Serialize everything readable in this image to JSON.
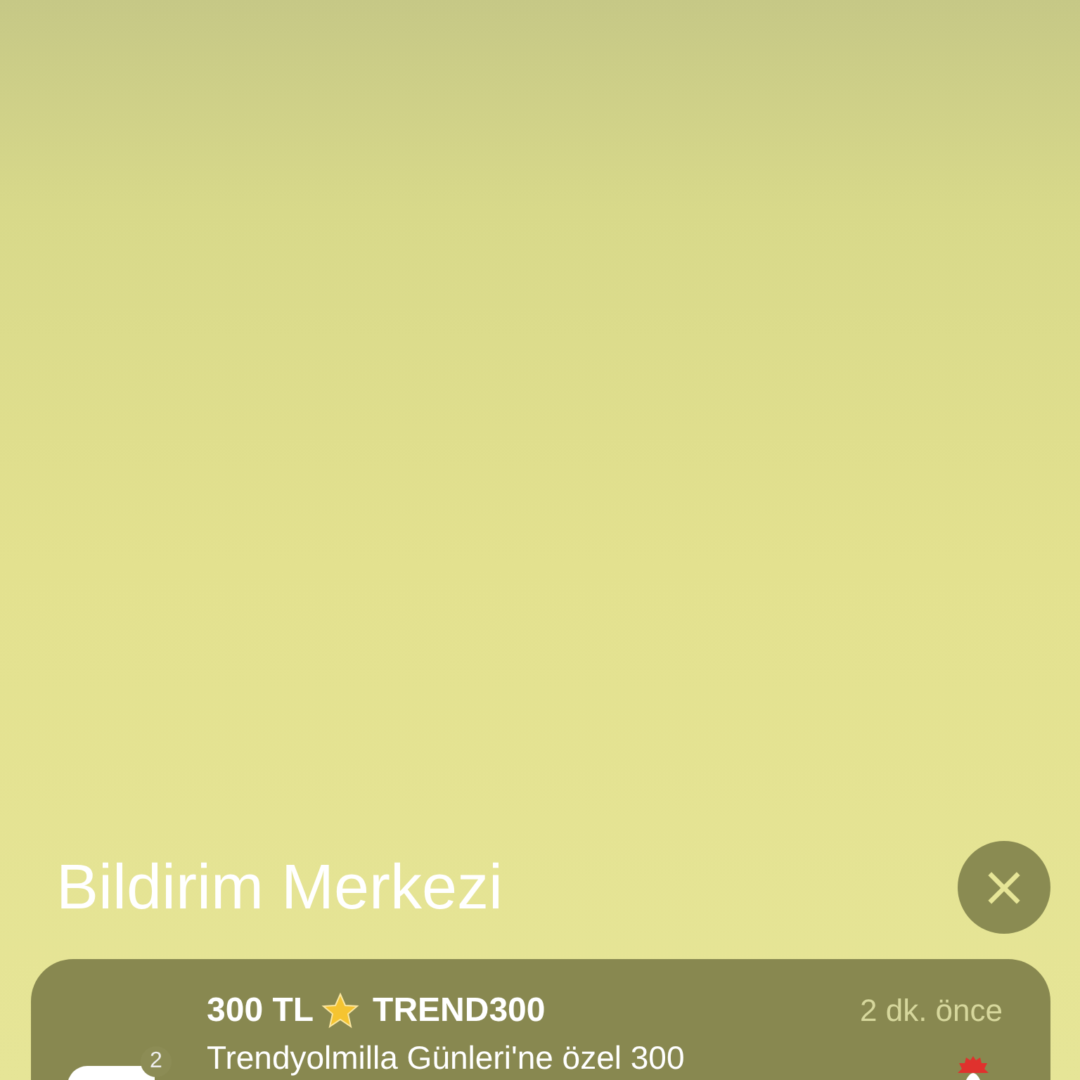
{
  "header": {
    "title": "Bildirim Merkezi",
    "close_symbol": "×"
  },
  "notifications": [
    {
      "title_parts": [
        "300 TL",
        "TREND300"
      ],
      "time": "2 dk. önce",
      "message": "Trendyolmilla Günleri'ne özel 300",
      "badge": "2"
    }
  ]
}
